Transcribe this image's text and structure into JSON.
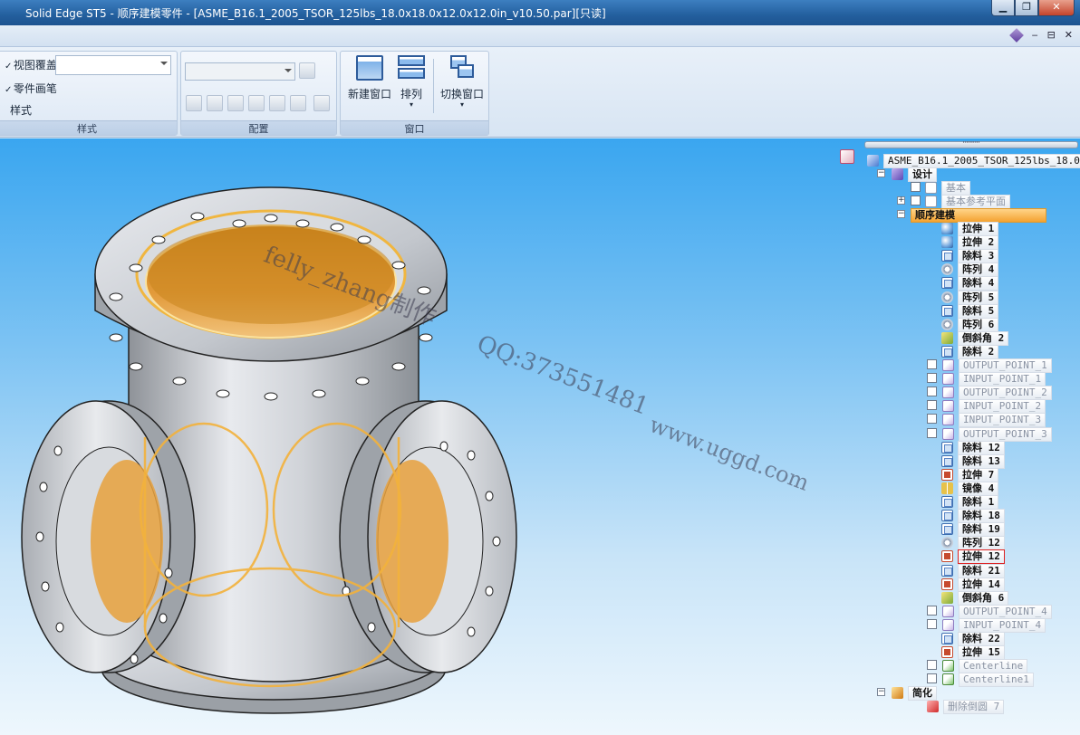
{
  "window": {
    "title": "Solid Edge ST5 - 顺序建模零件 - [ASME_B16.1_2005_TSOR_125lbs_18.0x18.0x12.0x12.0in_v10.50.par][只读]",
    "min_label": "▁",
    "restore_label": "❐",
    "close_label": "✕"
  },
  "tabrow": {
    "min_label": "‒",
    "restore_label": "⊟",
    "close_label": "✕"
  },
  "ribbon": {
    "style_group": {
      "view_overlay_label": "视图覆盖",
      "part_brush_label": "零件画笔",
      "style_label": "样式",
      "group_label": "样式"
    },
    "config_group": {
      "group_label": "配置"
    },
    "window_group": {
      "new_window_label": "新建窗口",
      "arrange_label": "排列",
      "switch_window_label": "切换窗口",
      "group_label": "窗口"
    }
  },
  "watermarks": {
    "author": "felly_zhang制作",
    "qq": "QQ:373551481",
    "site": "www.uggd.com"
  },
  "tree": {
    "root": "ASME_B16.1_2005_TSOR_125lbs_18.0",
    "design": "设计",
    "base": "基本",
    "base_planes": "基本参考平面",
    "sequential": "顺序建模",
    "features": [
      {
        "icon": "protrusion-icon",
        "label": "拉伸 1"
      },
      {
        "icon": "protrusion-icon",
        "label": "拉伸 2"
      },
      {
        "icon": "cutout-icon",
        "label": "除料 3"
      },
      {
        "icon": "pattern-icon",
        "label": "阵列 4"
      },
      {
        "icon": "cutout-icon",
        "label": "除料 4"
      },
      {
        "icon": "pattern-icon",
        "label": "阵列 5"
      },
      {
        "icon": "cutout-icon",
        "label": "除料 5"
      },
      {
        "icon": "pattern-icon",
        "label": "阵列 6"
      },
      {
        "icon": "chamfer-icon",
        "label": "倒斜角 2"
      },
      {
        "icon": "cutout-icon",
        "label": "除料 2"
      },
      {
        "icon": "point-icon",
        "label": "OUTPUT_POINT_1",
        "checkbox": true
      },
      {
        "icon": "point-icon",
        "label": "INPUT_POINT_1",
        "checkbox": true
      },
      {
        "icon": "point-icon",
        "label": "OUTPUT_POINT_2",
        "checkbox": true
      },
      {
        "icon": "point-icon",
        "label": "INPUT_POINT_2",
        "checkbox": true
      },
      {
        "icon": "point-icon",
        "label": "INPUT_POINT_3",
        "checkbox": true
      },
      {
        "icon": "point-icon",
        "label": "OUTPUT_POINT_3",
        "checkbox": true
      },
      {
        "icon": "cutout-icon",
        "label": "除料 12"
      },
      {
        "icon": "cutout-icon",
        "label": "除料 13"
      },
      {
        "icon": "extrude-icon",
        "label": "拉伸 7"
      },
      {
        "icon": "mirror-icon",
        "label": "镜像 4"
      },
      {
        "icon": "cutout-icon",
        "label": "除料 1"
      },
      {
        "icon": "cutout-icon",
        "label": "除料 18"
      },
      {
        "icon": "cutout-icon",
        "label": "除料 19"
      },
      {
        "icon": "pattern-icon",
        "label": "阵列 12"
      },
      {
        "icon": "extrude-icon",
        "label": "拉伸 12",
        "selected": true
      },
      {
        "icon": "cutout-icon",
        "label": "除料 21"
      },
      {
        "icon": "extrude-icon",
        "label": "拉伸 14"
      },
      {
        "icon": "chamfer-icon",
        "label": "倒斜角 6"
      },
      {
        "icon": "point-icon",
        "label": "OUTPUT_POINT_4",
        "checkbox": true
      },
      {
        "icon": "point-icon",
        "label": "INPUT_POINT_4",
        "checkbox": true
      },
      {
        "icon": "cutout-icon",
        "label": "除料 22"
      },
      {
        "icon": "extrude-icon",
        "label": "拉伸 15"
      },
      {
        "icon": "centerline-icon",
        "label": "Centerline",
        "checkbox": true
      },
      {
        "icon": "centerline-icon",
        "label": "Centerline1",
        "checkbox": true
      }
    ],
    "simplify": "简化",
    "delete_round": "删除倒圆 7"
  }
}
